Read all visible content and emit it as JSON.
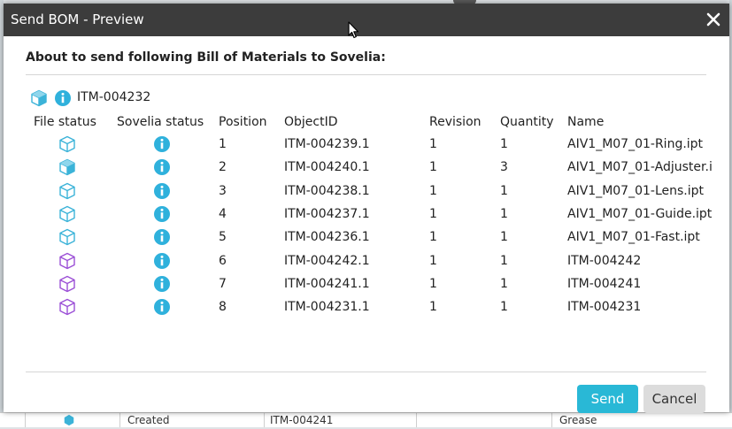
{
  "dialog": {
    "title": "Send BOM - Preview",
    "header": "About to send following Bill of Materials to Sovelia:",
    "root_item": "ITM-004232",
    "columns": {
      "file_status": "File status",
      "sovelia_status": "Sovelia status",
      "position": "Position",
      "object_id": "ObjectID",
      "revision": "Revision",
      "quantity": "Quantity",
      "name": "Name"
    },
    "rows": [
      {
        "file_icon": "cube-outline-icon",
        "position": "1",
        "object_id": "ITM-004239.1",
        "revision": "1",
        "quantity": "1",
        "name": "AIV1_M07_01-Ring.ipt"
      },
      {
        "file_icon": "cube-solid-icon",
        "position": "2",
        "object_id": "ITM-004240.1",
        "revision": "1",
        "quantity": "3",
        "name": "AIV1_M07_01-Adjuster.i"
      },
      {
        "file_icon": "cube-outline-icon",
        "position": "3",
        "object_id": "ITM-004238.1",
        "revision": "1",
        "quantity": "1",
        "name": "AIV1_M07_01-Lens.ipt"
      },
      {
        "file_icon": "cube-outline-icon",
        "position": "4",
        "object_id": "ITM-004237.1",
        "revision": "1",
        "quantity": "1",
        "name": "AIV1_M07_01-Guide.ipt"
      },
      {
        "file_icon": "cube-outline-icon",
        "position": "5",
        "object_id": "ITM-004236.1",
        "revision": "1",
        "quantity": "1",
        "name": "AIV1_M07_01-Fast.ipt"
      },
      {
        "file_icon": "cube-purple-icon",
        "position": "6",
        "object_id": "ITM-004242.1",
        "revision": "1",
        "quantity": "1",
        "name": "ITM-004242"
      },
      {
        "file_icon": "cube-purple-icon",
        "position": "7",
        "object_id": "ITM-004241.1",
        "revision": "1",
        "quantity": "1",
        "name": "ITM-004241"
      },
      {
        "file_icon": "cube-purple-icon",
        "position": "8",
        "object_id": "ITM-004231.1",
        "revision": "1",
        "quantity": "1",
        "name": "ITM-004231"
      }
    ],
    "send_label": "Send",
    "cancel_label": "Cancel"
  },
  "background": {
    "cells": [
      "Created",
      "ITM-004241",
      "Grease"
    ]
  },
  "colors": {
    "titlebar": "#3c3c3c",
    "accent": "#29b8d6",
    "part_icon": "#3bb3d8",
    "assembly_icon": "#9b4fd6",
    "info_icon": "#2fb1dc"
  }
}
